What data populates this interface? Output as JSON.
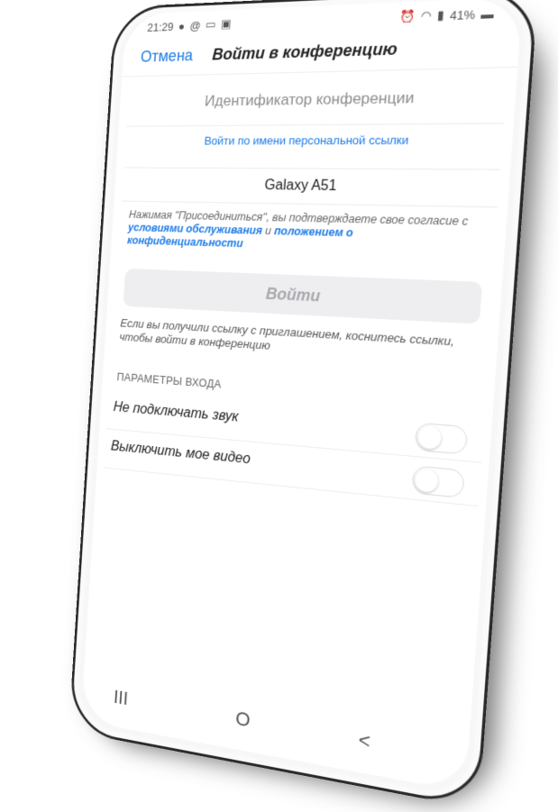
{
  "status_bar": {
    "time": "21:29",
    "left_icons": [
      "notification-icon",
      "at-icon",
      "message-icon",
      "gallery-icon"
    ],
    "right_text": "41%",
    "right_icons": [
      "alarm-icon",
      "wifi-icon",
      "volte-icon",
      "signal-icon",
      "battery-icon"
    ]
  },
  "header": {
    "cancel_label": "Отмена",
    "title": "Войти в конференцию"
  },
  "meeting_id": {
    "placeholder": "Идентификатор конференции"
  },
  "personal_link_label": "Войти по имени персональной ссылки",
  "display_name": {
    "value": "Galaxy A51"
  },
  "agreement": {
    "prefix": "Нажимая \"Присоединиться\", вы подтверждаете свое согласие с ",
    "terms_link": "условиями обслуживания",
    "middle": " и ",
    "privacy_link": "положением о конфиденциальности"
  },
  "join_button_label": "Войти",
  "invite_hint": "Если вы получили ссылку с приглашением, коснитесь ссылки, чтобы войти в конференцию",
  "options": {
    "section_title": "ПАРАМЕТРЫ ВХОДА",
    "items": [
      {
        "label": "Не подключать звук",
        "enabled": false
      },
      {
        "label": "Выключить мое видео",
        "enabled": false
      }
    ]
  },
  "nav_bar": {
    "recents_glyph": "III",
    "home_glyph": "O",
    "back_glyph": "<"
  },
  "colors": {
    "accent": "#1e7be6",
    "disabled_button_bg": "#eeeef0",
    "disabled_button_text": "#a8a8ae"
  }
}
